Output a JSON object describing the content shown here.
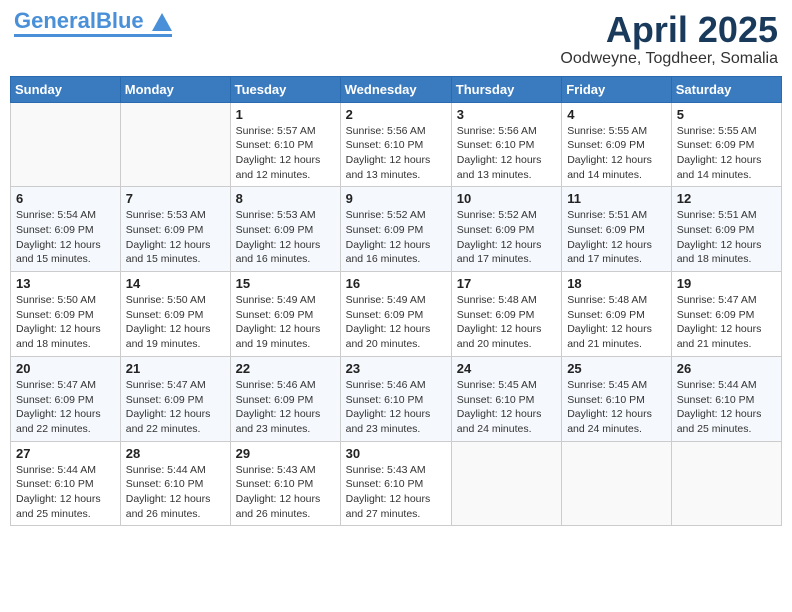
{
  "header": {
    "logo_general": "General",
    "logo_blue": "Blue",
    "month_title": "April 2025",
    "location": "Oodweyne, Togdheer, Somalia"
  },
  "weekdays": [
    "Sunday",
    "Monday",
    "Tuesday",
    "Wednesday",
    "Thursday",
    "Friday",
    "Saturday"
  ],
  "weeks": [
    [
      {
        "day": "",
        "sunrise": "",
        "sunset": "",
        "daylight": ""
      },
      {
        "day": "",
        "sunrise": "",
        "sunset": "",
        "daylight": ""
      },
      {
        "day": "1",
        "sunrise": "Sunrise: 5:57 AM",
        "sunset": "Sunset: 6:10 PM",
        "daylight": "Daylight: 12 hours and 12 minutes."
      },
      {
        "day": "2",
        "sunrise": "Sunrise: 5:56 AM",
        "sunset": "Sunset: 6:10 PM",
        "daylight": "Daylight: 12 hours and 13 minutes."
      },
      {
        "day": "3",
        "sunrise": "Sunrise: 5:56 AM",
        "sunset": "Sunset: 6:10 PM",
        "daylight": "Daylight: 12 hours and 13 minutes."
      },
      {
        "day": "4",
        "sunrise": "Sunrise: 5:55 AM",
        "sunset": "Sunset: 6:09 PM",
        "daylight": "Daylight: 12 hours and 14 minutes."
      },
      {
        "day": "5",
        "sunrise": "Sunrise: 5:55 AM",
        "sunset": "Sunset: 6:09 PM",
        "daylight": "Daylight: 12 hours and 14 minutes."
      }
    ],
    [
      {
        "day": "6",
        "sunrise": "Sunrise: 5:54 AM",
        "sunset": "Sunset: 6:09 PM",
        "daylight": "Daylight: 12 hours and 15 minutes."
      },
      {
        "day": "7",
        "sunrise": "Sunrise: 5:53 AM",
        "sunset": "Sunset: 6:09 PM",
        "daylight": "Daylight: 12 hours and 15 minutes."
      },
      {
        "day": "8",
        "sunrise": "Sunrise: 5:53 AM",
        "sunset": "Sunset: 6:09 PM",
        "daylight": "Daylight: 12 hours and 16 minutes."
      },
      {
        "day": "9",
        "sunrise": "Sunrise: 5:52 AM",
        "sunset": "Sunset: 6:09 PM",
        "daylight": "Daylight: 12 hours and 16 minutes."
      },
      {
        "day": "10",
        "sunrise": "Sunrise: 5:52 AM",
        "sunset": "Sunset: 6:09 PM",
        "daylight": "Daylight: 12 hours and 17 minutes."
      },
      {
        "day": "11",
        "sunrise": "Sunrise: 5:51 AM",
        "sunset": "Sunset: 6:09 PM",
        "daylight": "Daylight: 12 hours and 17 minutes."
      },
      {
        "day": "12",
        "sunrise": "Sunrise: 5:51 AM",
        "sunset": "Sunset: 6:09 PM",
        "daylight": "Daylight: 12 hours and 18 minutes."
      }
    ],
    [
      {
        "day": "13",
        "sunrise": "Sunrise: 5:50 AM",
        "sunset": "Sunset: 6:09 PM",
        "daylight": "Daylight: 12 hours and 18 minutes."
      },
      {
        "day": "14",
        "sunrise": "Sunrise: 5:50 AM",
        "sunset": "Sunset: 6:09 PM",
        "daylight": "Daylight: 12 hours and 19 minutes."
      },
      {
        "day": "15",
        "sunrise": "Sunrise: 5:49 AM",
        "sunset": "Sunset: 6:09 PM",
        "daylight": "Daylight: 12 hours and 19 minutes."
      },
      {
        "day": "16",
        "sunrise": "Sunrise: 5:49 AM",
        "sunset": "Sunset: 6:09 PM",
        "daylight": "Daylight: 12 hours and 20 minutes."
      },
      {
        "day": "17",
        "sunrise": "Sunrise: 5:48 AM",
        "sunset": "Sunset: 6:09 PM",
        "daylight": "Daylight: 12 hours and 20 minutes."
      },
      {
        "day": "18",
        "sunrise": "Sunrise: 5:48 AM",
        "sunset": "Sunset: 6:09 PM",
        "daylight": "Daylight: 12 hours and 21 minutes."
      },
      {
        "day": "19",
        "sunrise": "Sunrise: 5:47 AM",
        "sunset": "Sunset: 6:09 PM",
        "daylight": "Daylight: 12 hours and 21 minutes."
      }
    ],
    [
      {
        "day": "20",
        "sunrise": "Sunrise: 5:47 AM",
        "sunset": "Sunset: 6:09 PM",
        "daylight": "Daylight: 12 hours and 22 minutes."
      },
      {
        "day": "21",
        "sunrise": "Sunrise: 5:47 AM",
        "sunset": "Sunset: 6:09 PM",
        "daylight": "Daylight: 12 hours and 22 minutes."
      },
      {
        "day": "22",
        "sunrise": "Sunrise: 5:46 AM",
        "sunset": "Sunset: 6:09 PM",
        "daylight": "Daylight: 12 hours and 23 minutes."
      },
      {
        "day": "23",
        "sunrise": "Sunrise: 5:46 AM",
        "sunset": "Sunset: 6:10 PM",
        "daylight": "Daylight: 12 hours and 23 minutes."
      },
      {
        "day": "24",
        "sunrise": "Sunrise: 5:45 AM",
        "sunset": "Sunset: 6:10 PM",
        "daylight": "Daylight: 12 hours and 24 minutes."
      },
      {
        "day": "25",
        "sunrise": "Sunrise: 5:45 AM",
        "sunset": "Sunset: 6:10 PM",
        "daylight": "Daylight: 12 hours and 24 minutes."
      },
      {
        "day": "26",
        "sunrise": "Sunrise: 5:44 AM",
        "sunset": "Sunset: 6:10 PM",
        "daylight": "Daylight: 12 hours and 25 minutes."
      }
    ],
    [
      {
        "day": "27",
        "sunrise": "Sunrise: 5:44 AM",
        "sunset": "Sunset: 6:10 PM",
        "daylight": "Daylight: 12 hours and 25 minutes."
      },
      {
        "day": "28",
        "sunrise": "Sunrise: 5:44 AM",
        "sunset": "Sunset: 6:10 PM",
        "daylight": "Daylight: 12 hours and 26 minutes."
      },
      {
        "day": "29",
        "sunrise": "Sunrise: 5:43 AM",
        "sunset": "Sunset: 6:10 PM",
        "daylight": "Daylight: 12 hours and 26 minutes."
      },
      {
        "day": "30",
        "sunrise": "Sunrise: 5:43 AM",
        "sunset": "Sunset: 6:10 PM",
        "daylight": "Daylight: 12 hours and 27 minutes."
      },
      {
        "day": "",
        "sunrise": "",
        "sunset": "",
        "daylight": ""
      },
      {
        "day": "",
        "sunrise": "",
        "sunset": "",
        "daylight": ""
      },
      {
        "day": "",
        "sunrise": "",
        "sunset": "",
        "daylight": ""
      }
    ]
  ]
}
